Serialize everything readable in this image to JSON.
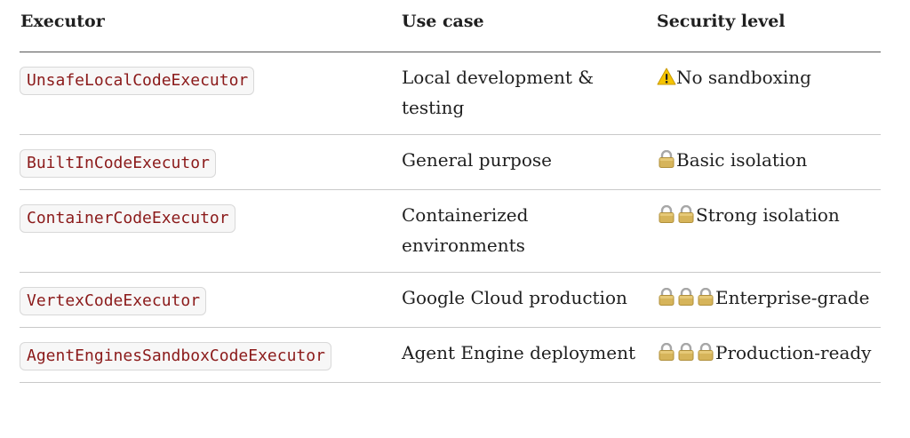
{
  "headers": {
    "executor": "Executor",
    "use_case": "Use case",
    "security_level": "Security level"
  },
  "rows": [
    {
      "executor": "UnsafeLocalCodeExecutor",
      "use_case": "Local development & testing",
      "security_icons": [
        "warning-icon"
      ],
      "security_text": "No sandboxing"
    },
    {
      "executor": "BuiltInCodeExecutor",
      "use_case": "General purpose",
      "security_icons": [
        "lock-icon"
      ],
      "security_text": "Basic isolation"
    },
    {
      "executor": "ContainerCodeExecutor",
      "use_case": "Containerized environments",
      "security_icons": [
        "lock-icon",
        "lock-icon"
      ],
      "security_text": "Strong isolation"
    },
    {
      "executor": "VertexCodeExecutor",
      "use_case": "Google Cloud production",
      "security_icons": [
        "lock-icon",
        "lock-icon",
        "lock-icon"
      ],
      "security_text": "Enterprise-grade"
    },
    {
      "executor": "AgentEnginesSandboxCodeExecutor",
      "use_case": "Agent Engine deployment",
      "security_icons": [
        "lock-icon",
        "lock-icon",
        "lock-icon"
      ],
      "security_text": "Production-ready"
    }
  ],
  "colors": {
    "code_text": "#8b1a1a",
    "code_bg": "#f7f7f7",
    "header_rule": "#555555",
    "row_rule": "#c9c9c9"
  }
}
